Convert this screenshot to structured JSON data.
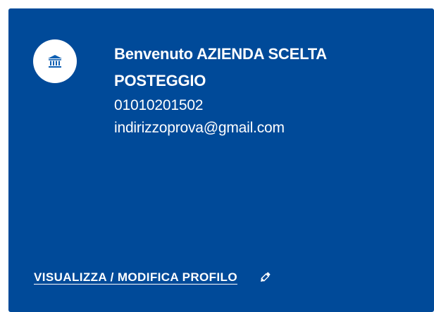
{
  "colors": {
    "card_background": "#004a99",
    "text": "#ffffff",
    "icon_accent": "#0d5fb3"
  },
  "user": {
    "avatar_icon": "bank-building-icon",
    "welcome_prefix": "Benvenuto",
    "company_name_line1": "AZIENDA SCELTA",
    "company_name_line2": "POSTEGGIO",
    "code": "01010201502",
    "email": "indirizzoprova@gmail.com"
  },
  "profile_link": {
    "label": "VISUALIZZA / MODIFICA PROFILO",
    "icon": "pencil-icon"
  }
}
